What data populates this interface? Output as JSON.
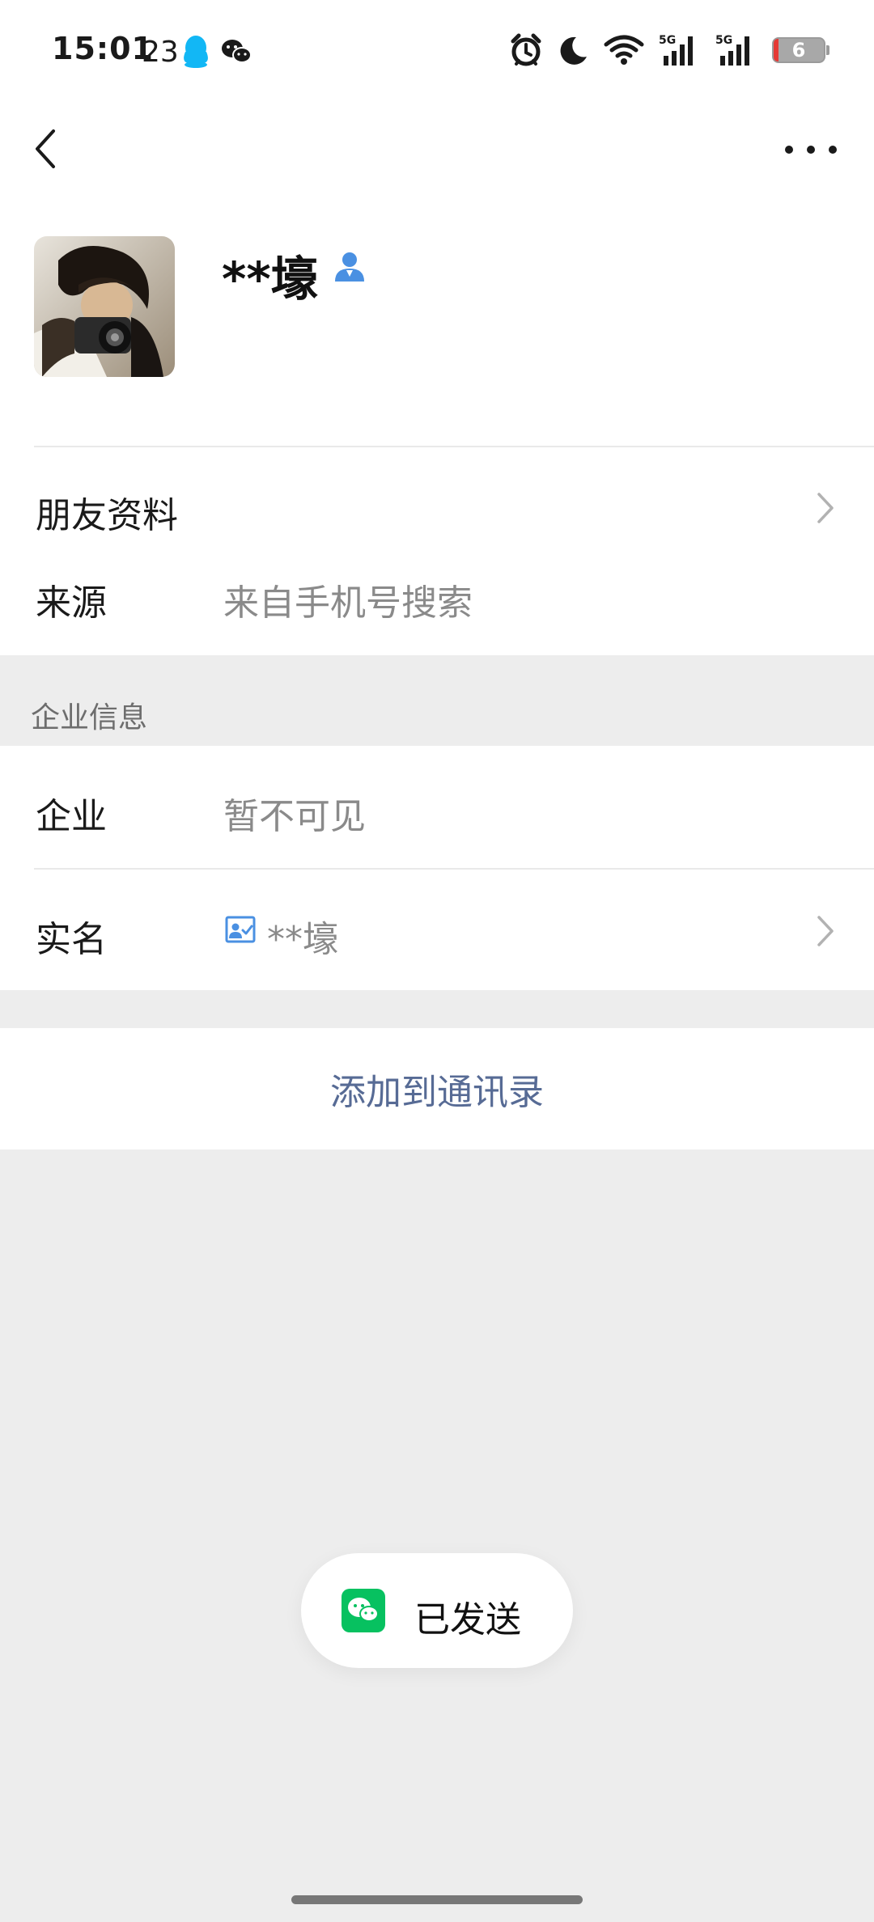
{
  "status_bar": {
    "time": "15:01",
    "notification_count": "23",
    "battery_level": "6",
    "icons": [
      "qq-icon",
      "wechat-icon",
      "alarm-icon",
      "moon-icon",
      "wifi-icon",
      "5g-signal-icon",
      "5g-signal-icon",
      "battery-icon"
    ]
  },
  "profile": {
    "name": "**壕"
  },
  "rows": {
    "friend_info_label": "朋友资料",
    "source_label": "来源",
    "source_value": "来自手机号搜索"
  },
  "enterprise": {
    "section_title": "企业信息",
    "company_label": "企业",
    "company_value": "暂不可见",
    "realname_label": "实名",
    "realname_value": "**壕"
  },
  "actions": {
    "add_contact_label": "添加到通讯录"
  },
  "toast": {
    "text": "已发送"
  },
  "colors": {
    "link": "#576b95",
    "wechat_green": "#07c160",
    "background": "#ededed"
  }
}
